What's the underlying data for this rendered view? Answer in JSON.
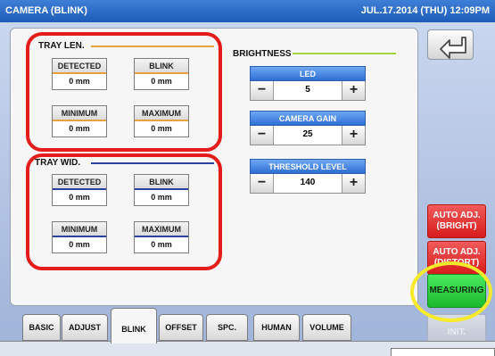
{
  "window": {
    "title": "CAMERA (BLINK)",
    "datetime": "JUL.17.2014 (THU) 12:09PM"
  },
  "tray_len": {
    "label": "TRAY LEN.",
    "detected": {
      "label": "DETECTED",
      "value": "0 mm"
    },
    "blink": {
      "label": "BLINK",
      "value": "0 mm"
    },
    "minimum": {
      "label": "MINIMUM",
      "value": "0 mm"
    },
    "maximum": {
      "label": "MAXIMUM",
      "value": "0 mm"
    }
  },
  "tray_wid": {
    "label": "TRAY WID.",
    "detected": {
      "label": "DETECTED",
      "value": "0 mm"
    },
    "blink": {
      "label": "BLINK",
      "value": "0 mm"
    },
    "minimum": {
      "label": "MINIMUM",
      "value": "0 mm"
    },
    "maximum": {
      "label": "MAXIMUM",
      "value": "0 mm"
    }
  },
  "brightness": {
    "label": "BRIGHTNESS",
    "led": {
      "label": "LED",
      "value": "5"
    },
    "camera_gain": {
      "label": "CAMERA GAIN",
      "value": "25"
    },
    "threshold": {
      "label": "THRESHOLD LEVEL",
      "value": "140"
    },
    "minus": "−",
    "plus": "+"
  },
  "side": {
    "auto_bright": "AUTO ADJ. (BRIGHT)",
    "auto_distort": "AUTO ADJ. (DISTORT)",
    "measuring": "MEASURING",
    "init": "INIT."
  },
  "tabs": [
    "BASIC",
    "ADJUST",
    "BLINK",
    "OFFSET",
    "SPC.",
    "HUMAN",
    "VOLUME"
  ],
  "colors": {
    "title_bar": "#2b6cc8",
    "red": "#e41c1c",
    "green": "#2bd13e",
    "yellow": "#f6ea2a"
  }
}
